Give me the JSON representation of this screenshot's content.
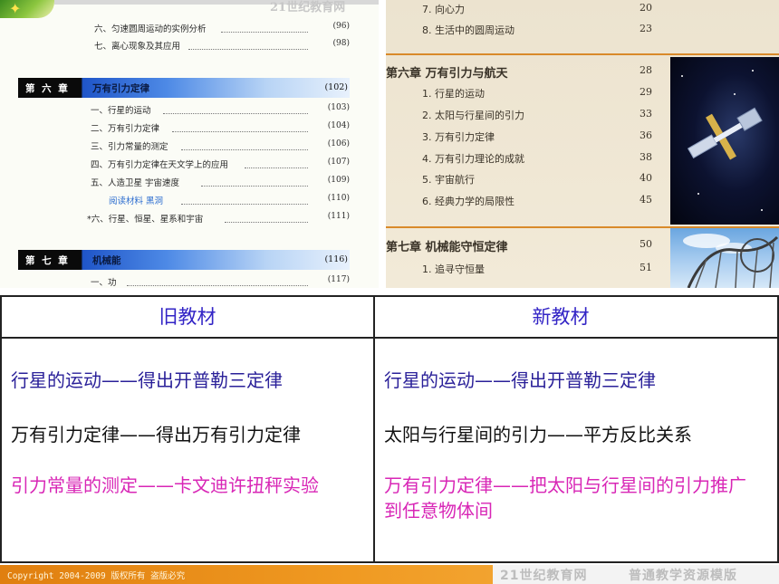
{
  "old_toc": {
    "top_items": [
      {
        "text": "六、匀速圆周运动的实例分析",
        "page": "(96)"
      },
      {
        "text": "七、离心现象及其应用",
        "page": "(98)"
      }
    ],
    "chapter6": {
      "number": "第 六 章",
      "title": "万有引力定律",
      "page": "(102)"
    },
    "chapter6_items": [
      {
        "text": "一、行星的运动",
        "page": "(103)"
      },
      {
        "text": "二、万有引力定律",
        "page": "(104)"
      },
      {
        "text": "三、引力常量的测定",
        "page": "(106)"
      },
      {
        "text": "四、万有引力定律在天文学上的应用",
        "page": "(107)"
      },
      {
        "text": "五、人造卫星  宇宙速度",
        "page": "(109)"
      },
      {
        "text": "阅读材料  黑洞",
        "page": "(110)"
      },
      {
        "text": "*六、行星、恒星、星系和宇宙",
        "page": "(111)"
      }
    ],
    "chapter7": {
      "number": "第 七 章",
      "title": "机械能",
      "page": "(116)"
    },
    "chapter7_items": [
      {
        "text": "一、功",
        "page": "(117)"
      }
    ]
  },
  "new_toc": {
    "top_items": [
      {
        "text": "7. 向心力",
        "page": "20"
      },
      {
        "text": "8. 生活中的圆周运动",
        "page": "23"
      }
    ],
    "chapter6": {
      "title": "第六章  万有引力与航天",
      "page": "28"
    },
    "chapter6_items": [
      {
        "text": "1. 行星的运动",
        "page": "29"
      },
      {
        "text": "2. 太阳与行星间的引力",
        "page": "33"
      },
      {
        "text": "3. 万有引力定律",
        "page": "36"
      },
      {
        "text": "4. 万有引力理论的成就",
        "page": "38"
      },
      {
        "text": "5. 宇宙航行",
        "page": "40"
      },
      {
        "text": "6. 经典力学的局限性",
        "page": "45"
      }
    ],
    "chapter7": {
      "title": "第七章  机械能守恒定律",
      "page": "50"
    },
    "chapter7_items": [
      {
        "text": "1. 追寻守恒量",
        "page": "51"
      }
    ]
  },
  "comparison": {
    "old_header": "旧教材",
    "new_header": "新教材",
    "old_rows": [
      "行星的运动——得出开普勒三定律",
      "万有引力定律——得出万有引力定律",
      "引力常量的测定——卡文迪许扭秤实验"
    ],
    "new_rows": [
      "行星的运动——得出开普勒三定律",
      "太阳与行星间的引力——平方反比关系",
      "万有引力定律——把太阳与行星间的引力推广到任意物体间"
    ]
  },
  "footer": {
    "copyright": "Copyright 2004-2009 版权所有 盗版必究",
    "site": "21世纪教育网",
    "template": "普通教学资源模版"
  },
  "watermark": "21世纪教育网",
  "colors": {
    "header_text": "#3325c6",
    "row1": "#2a2099",
    "row2": "#111111",
    "row3": "#d826b6",
    "footer_orange": "#f09a22",
    "chapter_band_blue": "#1f55c8"
  }
}
